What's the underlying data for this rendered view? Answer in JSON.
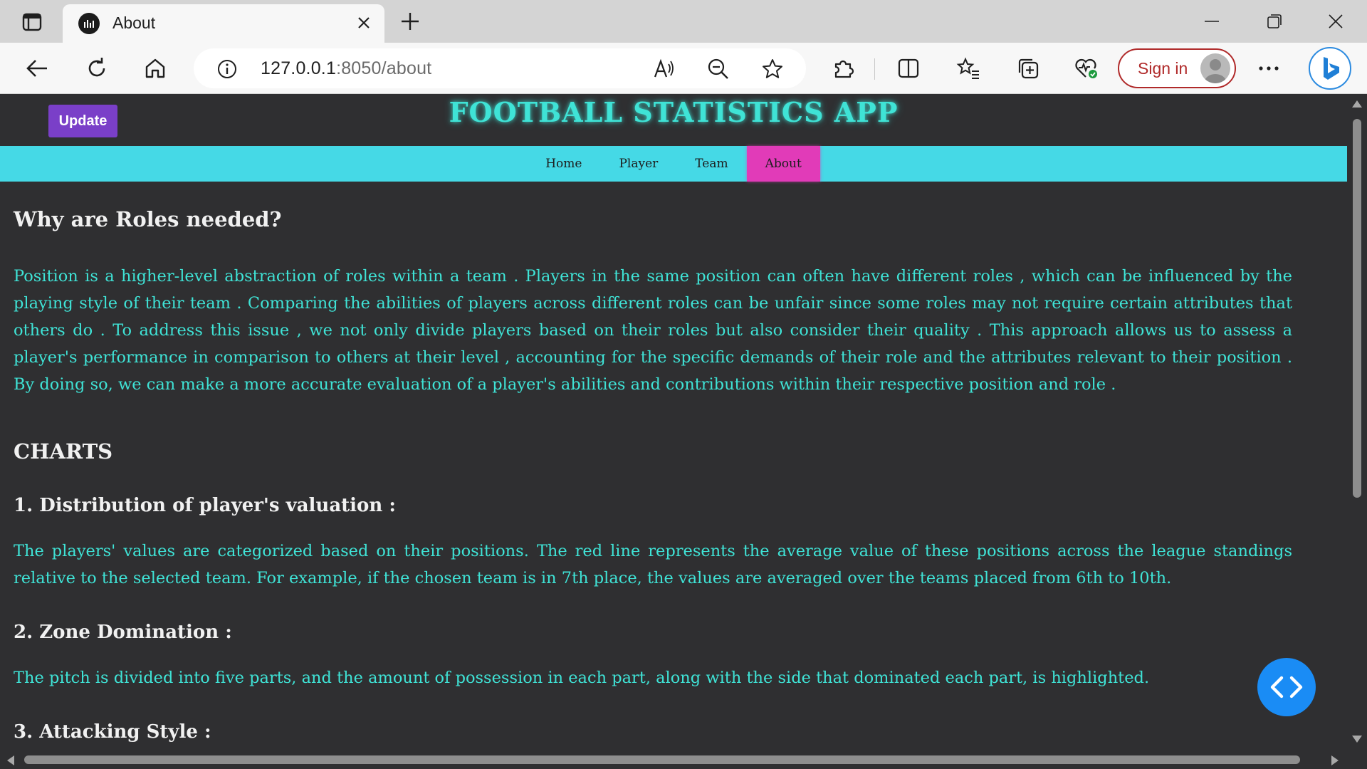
{
  "browser": {
    "tab_title": "About",
    "url_host": "127.0.0.1",
    "url_rest": ":8050/about",
    "signin_label": "Sign in"
  },
  "page": {
    "update_label": "Update",
    "app_title": "FOOTBALL STATISTICS APP",
    "nav": {
      "home": "Home",
      "player": "Player",
      "team": "Team",
      "about": "About",
      "active": "About"
    },
    "heading_roles": "Why are Roles needed?",
    "para_roles": "Position is a higher-level abstraction of roles within a team . Players in the same position can often have different roles , which can be influenced by the playing style of their team . Comparing the abilities of players across different roles can be unfair since some roles may not require certain attributes that others do . To address this issue , we not only divide players based on their roles but also consider their quality . This approach allows us to assess a player's performance in comparison to others at their level , accounting for the specific demands of their role and the attributes relevant to their position . By doing so, we can make a more accurate evaluation of a player's abilities and contributions within their respective position and role .",
    "heading_charts": "CHARTS",
    "chart1_heading": "1. Distribution of player's valuation :",
    "chart1_text": "The players' values are categorized based on their positions. The red line represents the average value of these positions across the league standings relative to the selected team. For example, if the chosen team is in 7th place, the values are averaged over the teams placed from 6th to 10th.",
    "chart2_heading": "2. Zone Domination :",
    "chart2_text": "The pitch is divided into five parts, and the amount of possession in each part, along with the side that dominated each part, is highlighted.",
    "chart3_heading": "3. Attacking Style :"
  },
  "colors": {
    "page_bg": "#2f2f31",
    "title_cyan": "#3fe3d6",
    "navbar_bg": "#45d9e6",
    "nav_active": "#e13bb8",
    "update_btn": "#7a3fc8",
    "fab_blue": "#1a8cf5"
  },
  "icons": [
    "sidebar-icon",
    "favicon-icon",
    "close-icon",
    "plus-icon",
    "minimize-icon",
    "maximize-icon",
    "back-icon",
    "refresh-icon",
    "home-icon",
    "info-icon",
    "read-aloud-icon",
    "zoom-out-icon",
    "star-icon",
    "extensions-icon",
    "split-screen-icon",
    "favorites-icon",
    "collections-icon",
    "browser-essentials-icon",
    "more-icon",
    "bing-icon",
    "code-icon"
  ]
}
